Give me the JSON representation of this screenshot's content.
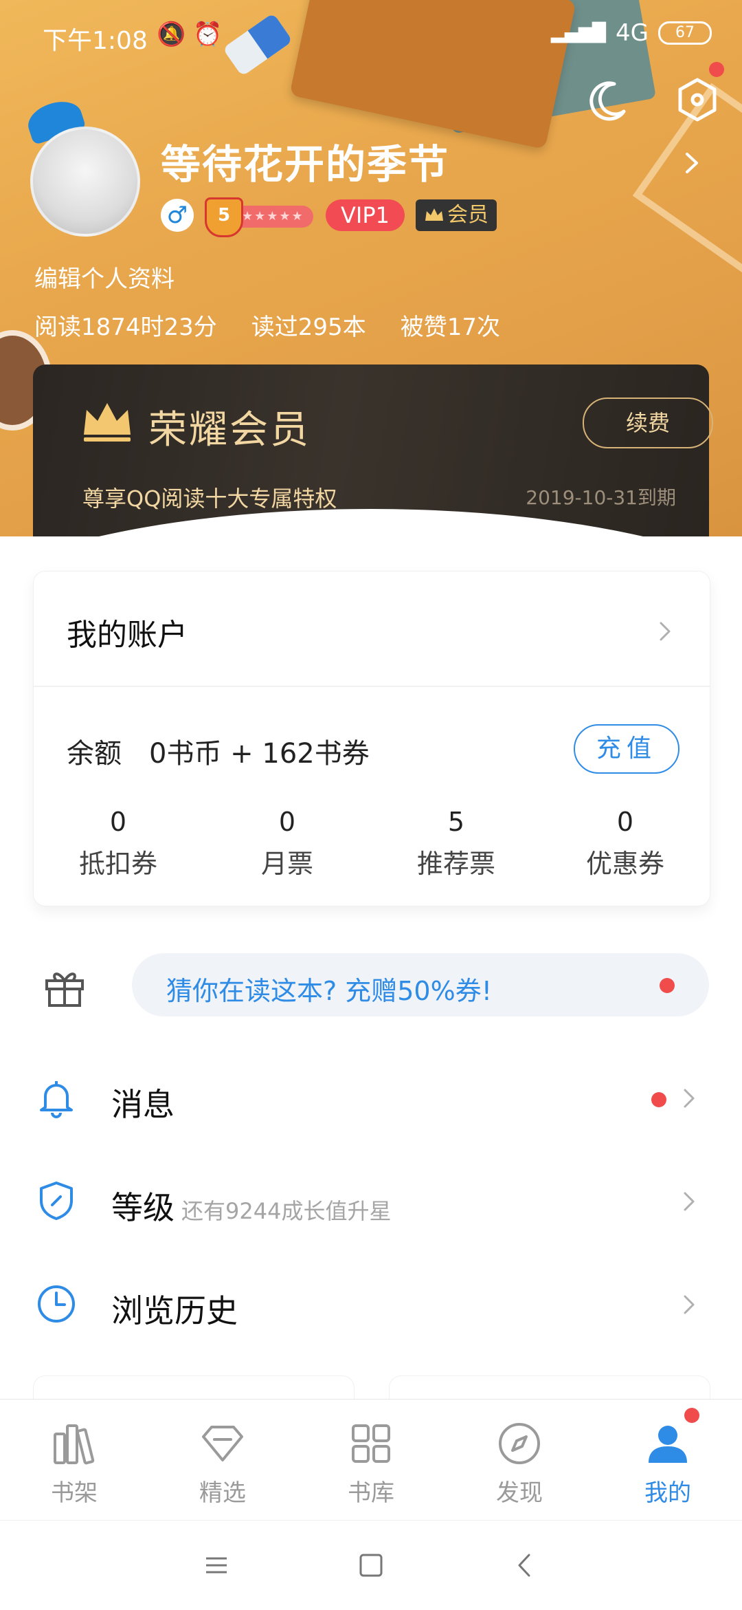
{
  "status_bar": {
    "time": "下午1:08",
    "network": "4G",
    "battery": "67"
  },
  "profile": {
    "username": "等待花开的季节",
    "level": "5",
    "vip_label": "VIP1",
    "member_label": "会员",
    "edit_label": "编辑个人资料",
    "stats": [
      {
        "label": "阅读1874时23分"
      },
      {
        "label": "读过295本"
      },
      {
        "label": "被赞17次"
      }
    ]
  },
  "vip_card": {
    "title": "荣耀会员",
    "renew_label": "续费",
    "description": "尊享QQ阅读十大专属特权",
    "expiry": "2019-10-31到期"
  },
  "account": {
    "title": "我的账户",
    "balance_label": "余额",
    "balance_value": "0书币 + 162书券",
    "recharge_label": "充值",
    "tickets": [
      {
        "value": "0",
        "label": "抵扣券"
      },
      {
        "value": "0",
        "label": "月票"
      },
      {
        "value": "5",
        "label": "推荐票"
      },
      {
        "value": "0",
        "label": "优惠券"
      }
    ]
  },
  "promo": {
    "text": "猜你在读这本? 充赠50%券!"
  },
  "menu": {
    "messages": {
      "label": "消息"
    },
    "level": {
      "label": "等级",
      "sub": "还有9244成长值升星"
    },
    "history": {
      "label": "浏览历史"
    }
  },
  "bottom_nav": [
    {
      "label": "书架",
      "icon": "bookshelf-icon"
    },
    {
      "label": "精选",
      "icon": "diamond-icon"
    },
    {
      "label": "书库",
      "icon": "grid-icon"
    },
    {
      "label": "发现",
      "icon": "compass-icon"
    },
    {
      "label": "我的",
      "icon": "profile-icon",
      "active": true
    }
  ],
  "colors": {
    "accent": "#2e8be6",
    "alert": "#f04c4c",
    "vip_gold": "#f3d7a3",
    "header_bg": "#e9a84d"
  }
}
